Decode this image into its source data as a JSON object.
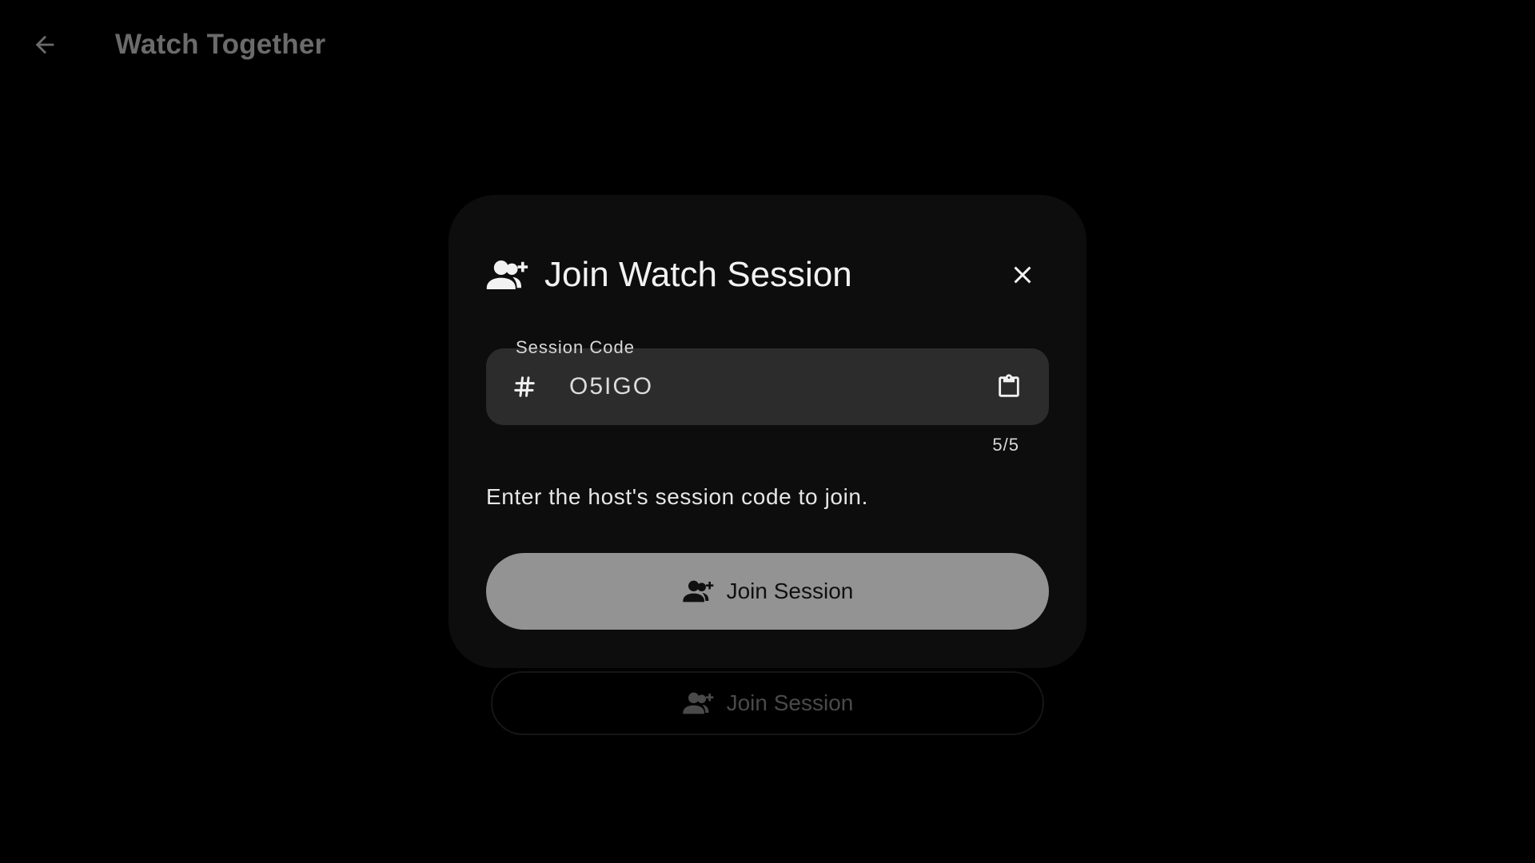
{
  "app_bar": {
    "title": "Watch Together",
    "back_icon": "arrow-back-icon"
  },
  "background": {
    "join_button_label": "Join Session",
    "join_button_icon": "group-add-icon"
  },
  "dialog": {
    "title": "Join Watch Session",
    "header_icon": "group-add-icon",
    "close_icon": "close-icon",
    "session_field": {
      "label": "Session Code",
      "value": "O5IGO",
      "prefix_icon": "hash-icon",
      "suffix_icon": "clipboard-icon",
      "counter": "5/5"
    },
    "helper_text": "Enter the host's session code to join.",
    "join_button": {
      "label": "Join Session",
      "icon": "group-add-icon"
    }
  },
  "colors": {
    "background": "#000000",
    "dialog": "#0d0d0d",
    "field": "#2c2c2c",
    "primary_button": "#939393",
    "dim_text": "#6b6b6b"
  }
}
